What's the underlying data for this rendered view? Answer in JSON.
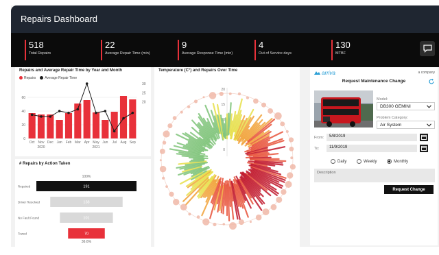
{
  "header": {
    "title": "Repairs Dashboard"
  },
  "kpis": [
    {
      "value": "518",
      "label": "Total Repairs"
    },
    {
      "value": "22",
      "label": "Average Repair Time (min)"
    },
    {
      "value": "9",
      "label": "Average Response Time (min)"
    },
    {
      "value": "4",
      "label": "Out of Service days"
    },
    {
      "value": "130",
      "label": "MTBF"
    }
  ],
  "colors": {
    "accent": "#e8313a",
    "dark": "#1f2631"
  },
  "repairs_chart": {
    "title": "Repairs and Average Repair Time by Year and Month",
    "legend": [
      "Repairs",
      "Average Repair Time"
    ],
    "years": [
      "2020",
      "2021"
    ]
  },
  "funnel": {
    "title": "# Repairs by Action Taken",
    "top_pct": "100%",
    "bottom_pct": "36.6%",
    "rows": [
      {
        "label": "Repaired",
        "value": "191"
      },
      {
        "label": "Driver Resolved",
        "value": "138"
      },
      {
        "label": "No Fault Found",
        "value": "101"
      },
      {
        "label": "Towed",
        "value": "70"
      }
    ]
  },
  "temp_chart": {
    "title": "Temperature (C°) and Repairs Over Time",
    "ticks": [
      "20",
      "15",
      "10",
      "5",
      "0"
    ]
  },
  "form": {
    "brand": "arriva",
    "brand_right": "a company",
    "title": "Request Maintenance Change",
    "model_label": "Model:",
    "model_value": "DB300 GEMINI",
    "category_label": "Problem Category:",
    "category_value": "Air System",
    "from_label": "From:",
    "from_value": "5/8/2019",
    "to_label": "To:",
    "to_value": "11/9/2019",
    "freq": [
      "Daily",
      "Weekly",
      "Monthly"
    ],
    "freq_selected": "Monthly",
    "description_label": "Description",
    "button_label": "Request Change"
  },
  "chart_data": [
    {
      "type": "bar",
      "title": "Repairs and Average Repair Time by Year and Month",
      "categories": [
        "Oct",
        "Nov",
        "Dec",
        "Jan",
        "Feb",
        "Mar",
        "Apr",
        "May",
        "Jun",
        "Jul",
        "Aug",
        "Sep"
      ],
      "series": [
        {
          "name": "Repairs",
          "type": "bar",
          "values": [
            37,
            35,
            35,
            27,
            37,
            51,
            56,
            38,
            27,
            39,
            62,
            57
          ]
        },
        {
          "name": "Average Repair Time",
          "type": "line",
          "values": [
            13,
            12,
            12,
            15,
            14,
            16,
            30,
            14,
            15,
            4,
            11,
            14
          ]
        }
      ],
      "ylim_left": [
        0,
        80
      ],
      "yticks_left": [
        0,
        20,
        40,
        60
      ],
      "ylim_right": [
        0,
        30
      ],
      "yticks_right": [
        20,
        25,
        30
      ],
      "colors": [
        "#e8313a",
        "#1c1c1c"
      ],
      "legend_position": "top-left"
    },
    {
      "type": "bar",
      "title": "# Repairs by Action Taken",
      "categories": [
        "Repaired",
        "Driver Resolved",
        "No Fault Found",
        "Towed"
      ],
      "values": [
        191,
        138,
        101,
        70
      ],
      "colors": [
        "#111111",
        "#d9d9d9",
        "#d9d9d9",
        "#e8313a"
      ]
    }
  ]
}
